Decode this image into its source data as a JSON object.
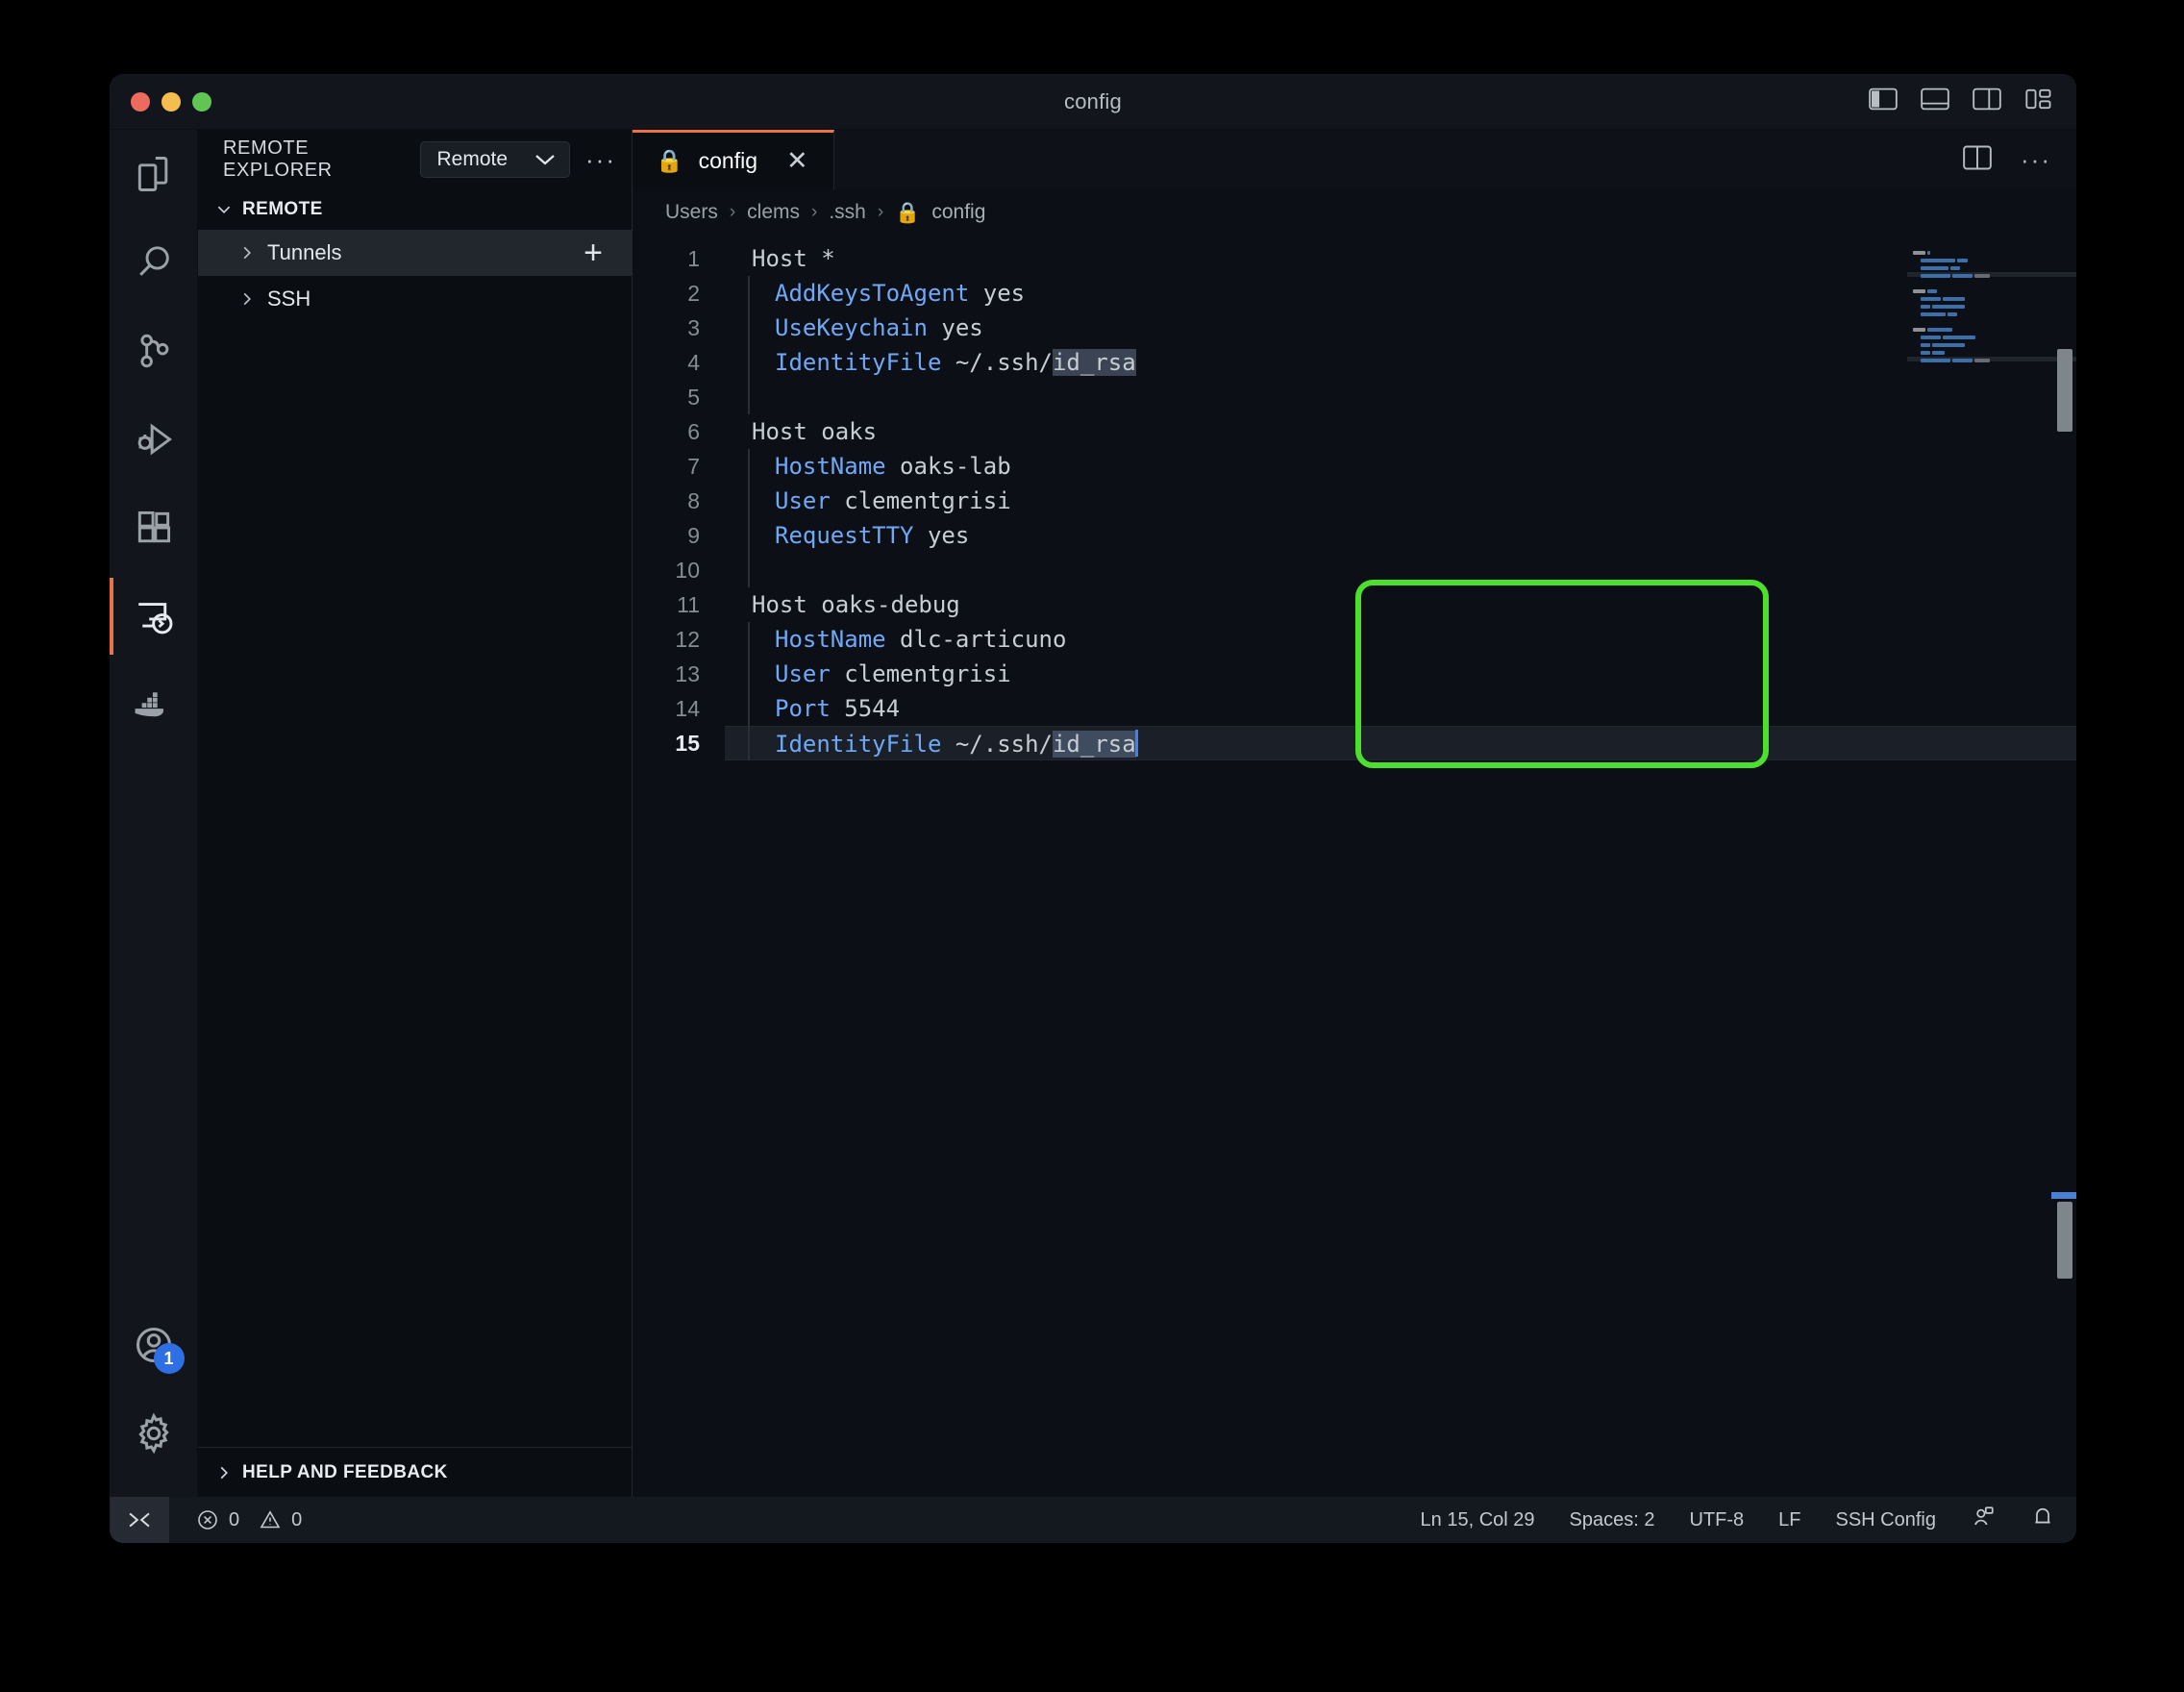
{
  "window": {
    "title": "config",
    "traffic_lights": [
      "close-red",
      "minimize-yellow",
      "maximize-green"
    ],
    "layout_toggles": [
      {
        "name": "toggle-primary-sidebar",
        "icon": "panel-left-icon"
      },
      {
        "name": "toggle-panel",
        "icon": "panel-bottom-icon"
      },
      {
        "name": "toggle-secondary-sidebar",
        "icon": "panel-right-icon"
      },
      {
        "name": "customize-layout",
        "icon": "layout-grid-icon"
      }
    ]
  },
  "activitybar": {
    "items": [
      {
        "name": "explorer",
        "icon": "files-icon",
        "active": false
      },
      {
        "name": "search",
        "icon": "search-icon",
        "active": false
      },
      {
        "name": "source-control",
        "icon": "source-control-icon",
        "active": false
      },
      {
        "name": "run-and-debug",
        "icon": "debug-icon",
        "active": false
      },
      {
        "name": "extensions",
        "icon": "extensions-icon",
        "active": false
      },
      {
        "name": "remote-explorer",
        "icon": "remote-explorer-icon",
        "active": true
      },
      {
        "name": "docker",
        "icon": "docker-icon",
        "active": false
      }
    ],
    "account": {
      "icon": "account-icon",
      "badge": "1"
    },
    "settings": {
      "icon": "gear-icon"
    }
  },
  "sidebar": {
    "title": "REMOTE EXPLORER",
    "select_value": "Remote",
    "more_actions": "···",
    "section": "REMOTE",
    "tree": [
      {
        "label": "Tunnels",
        "selected": true,
        "has_add": true
      },
      {
        "label": "SSH",
        "selected": false,
        "has_add": false
      }
    ],
    "bottom_section": "HELP AND FEEDBACK"
  },
  "editor": {
    "tab": {
      "label": "config",
      "icon": "lock-icon",
      "close": "✕"
    },
    "actions": [
      {
        "name": "split-editor-right",
        "icon": "split-editor-icon"
      },
      {
        "name": "more-editor-actions",
        "icon": "ellipsis-icon"
      }
    ],
    "breadcrumb": [
      "Users",
      "clems",
      ".ssh",
      "config"
    ],
    "breadcrumb_separator": "›",
    "breadcrumb_file_icon": "lock-icon",
    "language_lines": [
      {
        "num": "1",
        "indent": false,
        "segments": [
          {
            "t": "Host ",
            "c": "host"
          },
          {
            "t": "*",
            "c": "val"
          }
        ]
      },
      {
        "num": "2",
        "indent": true,
        "segments": [
          {
            "t": "AddKeysToAgent",
            "c": "key"
          },
          {
            "t": " yes",
            "c": "val"
          }
        ]
      },
      {
        "num": "3",
        "indent": true,
        "segments": [
          {
            "t": "UseKeychain",
            "c": "key"
          },
          {
            "t": " yes",
            "c": "val"
          }
        ]
      },
      {
        "num": "4",
        "indent": true,
        "segments": [
          {
            "t": "IdentityFile",
            "c": "key"
          },
          {
            "t": " ~/.ssh/",
            "c": "val"
          },
          {
            "t": "id_rsa",
            "c": "sel"
          }
        ]
      },
      {
        "num": "5",
        "indent": true,
        "segments": []
      },
      {
        "num": "6",
        "indent": false,
        "segments": [
          {
            "t": "Host ",
            "c": "host"
          },
          {
            "t": "oaks",
            "c": "val"
          }
        ]
      },
      {
        "num": "7",
        "indent": true,
        "segments": [
          {
            "t": "HostName",
            "c": "key"
          },
          {
            "t": " oaks-lab",
            "c": "val"
          }
        ]
      },
      {
        "num": "8",
        "indent": true,
        "segments": [
          {
            "t": "User",
            "c": "key"
          },
          {
            "t": " clementgrisi",
            "c": "val"
          }
        ]
      },
      {
        "num": "9",
        "indent": true,
        "segments": [
          {
            "t": "RequestTTY",
            "c": "key"
          },
          {
            "t": " yes",
            "c": "val"
          }
        ]
      },
      {
        "num": "10",
        "indent": true,
        "segments": []
      },
      {
        "num": "11",
        "indent": false,
        "segments": [
          {
            "t": "Host ",
            "c": "host"
          },
          {
            "t": "oaks-debug",
            "c": "val"
          }
        ]
      },
      {
        "num": "12",
        "indent": true,
        "segments": [
          {
            "t": "HostName",
            "c": "key"
          },
          {
            "t": " dlc-articuno",
            "c": "val"
          }
        ]
      },
      {
        "num": "13",
        "indent": true,
        "segments": [
          {
            "t": "User",
            "c": "key"
          },
          {
            "t": " clementgrisi",
            "c": "val"
          }
        ]
      },
      {
        "num": "14",
        "indent": true,
        "segments": [
          {
            "t": "Port",
            "c": "key"
          },
          {
            "t": " 5544",
            "c": "val"
          }
        ]
      },
      {
        "num": "15",
        "indent": true,
        "current": true,
        "segments": [
          {
            "t": "IdentityFile",
            "c": "key"
          },
          {
            "t": " ~/.ssh/",
            "c": "val"
          },
          {
            "t": "id_rsa",
            "c": "selfocus"
          }
        ]
      }
    ],
    "annotation": {
      "shape": "rounded-rect",
      "color": "#4ce02e",
      "covers_lines": "11-15"
    }
  },
  "statusbar": {
    "remote_indicator": "»«",
    "errors": "0",
    "warnings": "0",
    "cursor_position": "Ln 15, Col 29",
    "indentation": "Spaces: 2",
    "encoding": "UTF-8",
    "eol": "LF",
    "language_mode": "SSH Config",
    "right_icons": [
      {
        "name": "live-share-icon"
      },
      {
        "name": "bell-icon"
      }
    ]
  }
}
